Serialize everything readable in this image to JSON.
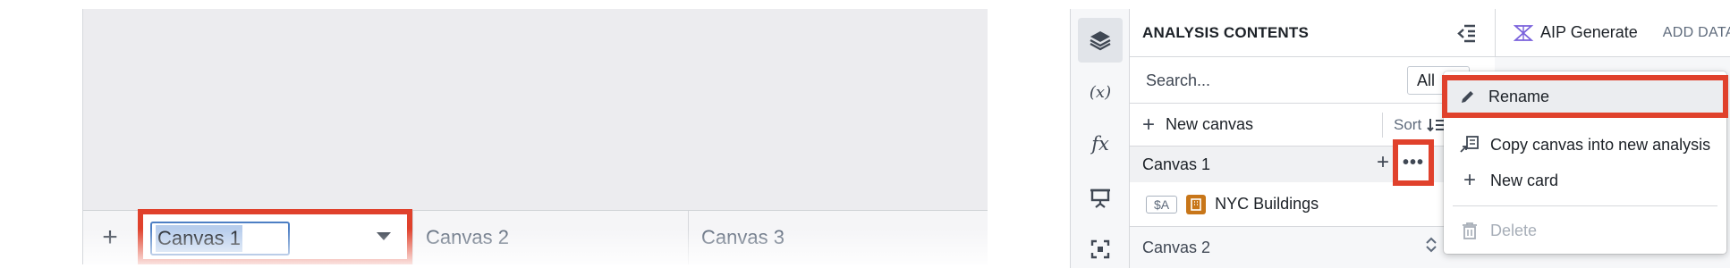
{
  "left_panel": {
    "add_tab_label": "+",
    "tabs": [
      {
        "label": "Canvas 1",
        "editing": true
      },
      {
        "label": "Canvas 2"
      },
      {
        "label": "Canvas 3"
      }
    ]
  },
  "right_panel": {
    "rail_icons": [
      "layers-icon",
      "variables-icon",
      "function-icon",
      "presentation-icon",
      "focus-icon"
    ],
    "rail_text": {
      "variables": "(x)",
      "function": "fx"
    },
    "header_title": "ANALYSIS CONTENTS",
    "search_placeholder": "Search...",
    "filter_value": "All",
    "new_canvas_label": "New canvas",
    "sort_label": "Sort",
    "canvases": [
      {
        "label": "Canvas 1",
        "items": [
          {
            "var": "$A",
            "name": "NYC Buildings"
          }
        ]
      },
      {
        "label": "Canvas 2"
      }
    ],
    "more_label": "•••",
    "toolbar": {
      "aip_label": "AIP Generate",
      "add_data_label": "ADD DATA"
    }
  },
  "context_menu": {
    "items": [
      {
        "label": "Rename",
        "icon": "pencil-icon",
        "highlighted": true
      },
      {
        "label": "Copy canvas into new analysis",
        "icon": "copy-icon"
      },
      {
        "label": "New card",
        "icon": "plus-icon"
      },
      {
        "label": "Delete",
        "icon": "trash-icon",
        "disabled": true
      }
    ]
  },
  "colors": {
    "highlight_border": "#e0412c",
    "input_focus": "#4d7fc4",
    "text_selection": "#b7cdec",
    "dataset_icon": "#c87619",
    "aip_icon": "#7961db"
  }
}
